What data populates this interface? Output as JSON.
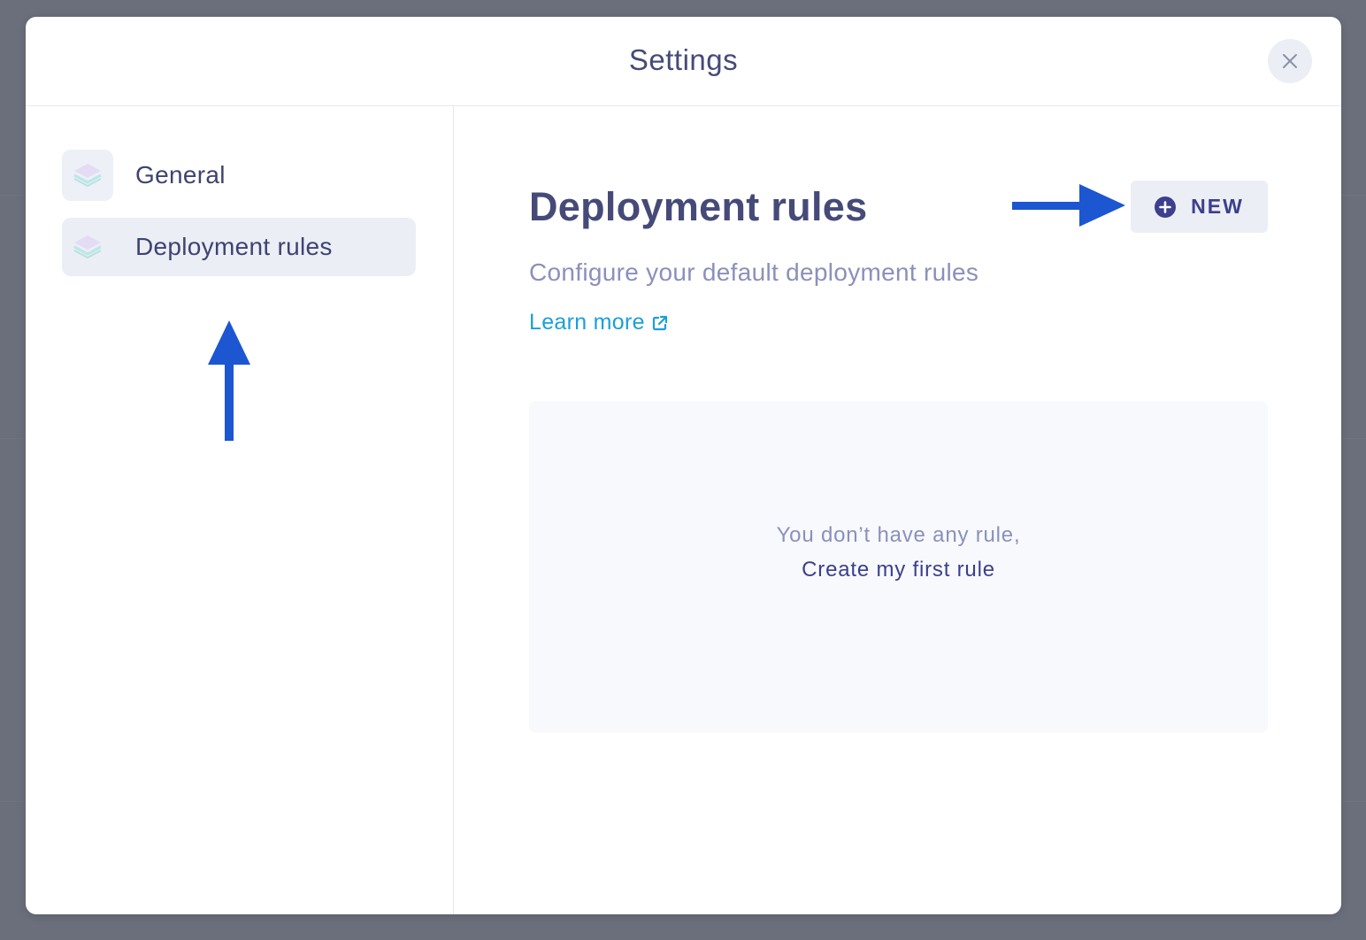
{
  "modal": {
    "title": "Settings"
  },
  "sidebar": {
    "items": [
      {
        "label": "General",
        "icon": "layers-icon",
        "active": false
      },
      {
        "label": "Deployment rules",
        "icon": "layers-icon",
        "active": true
      }
    ]
  },
  "main": {
    "title": "Deployment rules",
    "new_button_label": "NEW",
    "subtitle": "Configure your default deployment rules",
    "learn_more_label": "Learn more",
    "empty_state": {
      "message": "You don’t have any rule,",
      "link_label": "Create my first rule"
    }
  },
  "colors": {
    "overlay": "#6b6f7c",
    "primary_text": "#454a78",
    "muted_text": "#8b90bb",
    "link": "#1a9fdb",
    "accent": "#3b3f8c",
    "annotation_arrow": "#1c56d1"
  }
}
